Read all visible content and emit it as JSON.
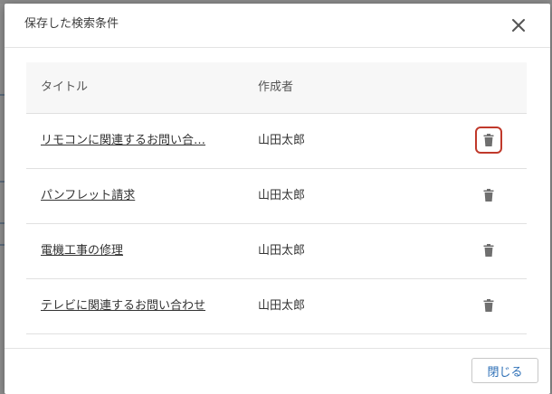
{
  "dialog": {
    "title": "保存した検索条件",
    "close_icon": "close-icon"
  },
  "table": {
    "headers": {
      "title": "タイトル",
      "author": "作成者"
    },
    "rows": [
      {
        "title": "リモコンに関連するお問い合…",
        "author": "山田太郎",
        "focused": true
      },
      {
        "title": "パンフレット請求",
        "author": "山田太郎",
        "focused": false
      },
      {
        "title": "電機工事の修理",
        "author": "山田太郎",
        "focused": false
      },
      {
        "title": "テレビに関連するお問い合わせ",
        "author": "山田太郎",
        "focused": false
      }
    ],
    "delete_icon": "trash-icon"
  },
  "footer": {
    "close_label": "閉じる"
  },
  "colors": {
    "focus_outline": "#c0392b",
    "link_button_text": "#2d6fb6",
    "icon_gray": "#6f6f6f"
  }
}
